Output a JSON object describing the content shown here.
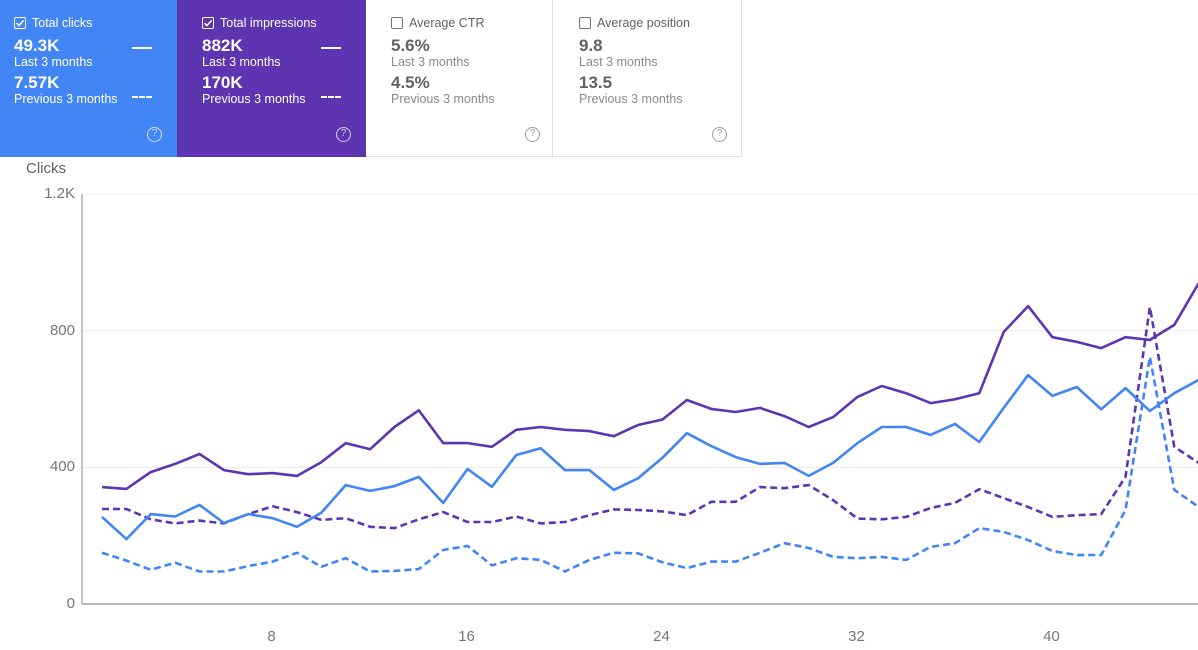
{
  "cards": [
    {
      "title": "Total clicks",
      "checked": true,
      "current_value": "49.3K",
      "current_label": "Last 3 months",
      "previous_value": "7.57K",
      "previous_label": "Previous 3 months",
      "color": "#4285f4",
      "help_icon": "help-circle-icon"
    },
    {
      "title": "Total impressions",
      "checked": true,
      "current_value": "882K",
      "current_label": "Last 3 months",
      "previous_value": "170K",
      "previous_label": "Previous 3 months",
      "color": "#5e35b1",
      "help_icon": "help-circle-icon"
    },
    {
      "title": "Average CTR",
      "checked": false,
      "current_value": "5.6%",
      "current_label": "Last 3 months",
      "previous_value": "4.5%",
      "previous_label": "Previous 3 months",
      "help_icon": "help-circle-icon"
    },
    {
      "title": "Average position",
      "checked": false,
      "current_value": "9.8",
      "current_label": "Last 3 months",
      "previous_value": "13.5",
      "previous_label": "Previous 3 months",
      "help_icon": "help-circle-icon"
    }
  ],
  "help_glyph": "?",
  "chart_data": {
    "type": "line",
    "title": "",
    "ylabel": "Clicks",
    "xlabel": "",
    "ylim": [
      0,
      1200
    ],
    "yticks": [
      0,
      400,
      800,
      1200
    ],
    "ytick_labels": [
      "0",
      "400",
      "800",
      "1.2K"
    ],
    "xticks": [
      8,
      16,
      24,
      32,
      40
    ],
    "xtick_labels": [
      "8",
      "16",
      "24",
      "32",
      "40"
    ],
    "xlim": [
      0.2,
      46
    ],
    "grid": true,
    "x": [
      1,
      2,
      3,
      4,
      5,
      6,
      7,
      8,
      9,
      10,
      11,
      12,
      13,
      14,
      15,
      16,
      17,
      18,
      19,
      20,
      21,
      22,
      23,
      24,
      25,
      26,
      27,
      28,
      29,
      30,
      31,
      32,
      33,
      34,
      35,
      36,
      37,
      38,
      39,
      40,
      41,
      42,
      43,
      44,
      45,
      46
    ],
    "series": [
      {
        "name": "Total impressions (Last 3 months)",
        "color": "#5e35b1",
        "style": "solid",
        "values": [
          342,
          337,
          386,
          410,
          439,
          392,
          380,
          383,
          375,
          415,
          471,
          453,
          518,
          567,
          471,
          471,
          460,
          510,
          518,
          510,
          506,
          491,
          524,
          540,
          597,
          571,
          562,
          574,
          550,
          518,
          547,
          606,
          638,
          617,
          588,
          599,
          617,
          796,
          872,
          781,
          767,
          749,
          781,
          773,
          817,
          939
        ]
      },
      {
        "name": "Total clicks (Last 3 months)",
        "color": "#4285f4",
        "style": "solid",
        "values": [
          255,
          190,
          263,
          256,
          290,
          237,
          263,
          251,
          226,
          267,
          348,
          331,
          345,
          372,
          296,
          395,
          343,
          436,
          456,
          392,
          392,
          334,
          368,
          428,
          500,
          462,
          430,
          410,
          413,
          375,
          413,
          471,
          518,
          518,
          495,
          527,
          474,
          574,
          670,
          609,
          635,
          570,
          632,
          565,
          617,
          656
        ]
      },
      {
        "name": "Total impressions (Previous 3 months)",
        "color": "#5e35b1",
        "style": "dashed",
        "values": [
          278,
          278,
          248,
          236,
          244,
          236,
          263,
          286,
          269,
          246,
          251,
          226,
          222,
          248,
          269,
          240,
          240,
          256,
          236,
          240,
          260,
          277,
          275,
          271,
          260,
          299,
          299,
          342,
          339,
          348,
          304,
          250,
          248,
          255,
          281,
          296,
          336,
          310,
          284,
          255,
          260,
          263,
          372,
          869,
          460,
          413
        ]
      },
      {
        "name": "Total clicks (Previous 3 months)",
        "color": "#4285f4",
        "style": "dashed",
        "values": [
          150,
          127,
          100,
          121,
          95,
          95,
          111,
          124,
          150,
          109,
          134,
          95,
          97,
          102,
          158,
          170,
          113,
          134,
          129,
          95,
          129,
          150,
          148,
          122,
          105,
          124,
          124,
          150,
          178,
          164,
          138,
          134,
          138,
          129,
          167,
          178,
          222,
          211,
          187,
          155,
          143,
          143,
          275,
          723,
          334,
          284
        ]
      }
    ]
  }
}
